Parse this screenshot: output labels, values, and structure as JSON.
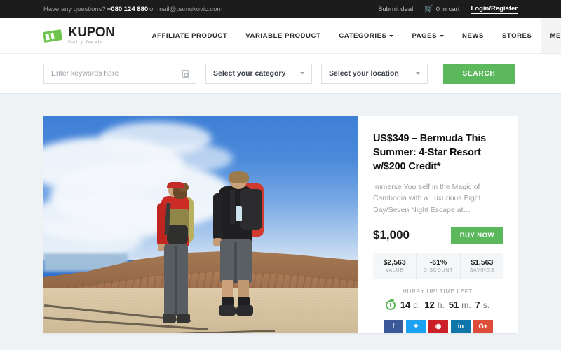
{
  "topbar": {
    "question_text": "Have any questions? ",
    "phone": "+080 124 880",
    "mail_text": " or mail@pamukovic.com",
    "submit_deal": "Submit deal",
    "cart_text": "0 in cart",
    "cart_icon": "cart-icon",
    "login_register": "Login/Register"
  },
  "header": {
    "logo_name": "KUPON",
    "logo_sub": "Daily Deals",
    "nav": [
      {
        "label": "AFFILIATE PRODUCT",
        "caret": false,
        "active": false
      },
      {
        "label": "VARIABLE PRODUCT",
        "caret": false,
        "active": false
      },
      {
        "label": "CATEGORIES",
        "caret": true,
        "active": false
      },
      {
        "label": "PAGES",
        "caret": true,
        "active": false
      },
      {
        "label": "NEWS",
        "caret": false,
        "active": false
      },
      {
        "label": "STORES",
        "caret": false,
        "active": false
      },
      {
        "label": "MEGA MENU",
        "caret": true,
        "active": true
      }
    ]
  },
  "search": {
    "keywords_placeholder": "Enter keywords here",
    "keywords_value": "",
    "keywords_icon": "keyboard-icon",
    "category_selected": "Select your category",
    "location_selected": "Select your location",
    "search_button": "SEARCH"
  },
  "deal": {
    "image_alt": "two-hikers-with-backpacks-on-desert-ridge",
    "title": "US$349 – Bermuda This Summer: 4-Star Resort w/$200 Credit*",
    "description": "Immerse Yourself in the Magic of Cambodia with a Luxurious Eight Day/Seven Night Escape at…",
    "price": "$1,000",
    "buy_button": "BUY NOW",
    "stats": [
      {
        "value": "$2,563",
        "label": "VALUE"
      },
      {
        "value": "-61%",
        "label": "DISCOUNT"
      },
      {
        "value": "$1,563",
        "label": "SAVINGS"
      }
    ],
    "timer_label": "HURRY UP! TIME LEFT:",
    "timer": [
      {
        "num": "14",
        "unit": "d."
      },
      {
        "num": "12",
        "unit": "h."
      },
      {
        "num": "51",
        "unit": "m."
      },
      {
        "num": "7",
        "unit": "s."
      }
    ],
    "social": [
      {
        "name": "facebook-share-button",
        "glyph": "f",
        "color": "#3b5998"
      },
      {
        "name": "twitter-share-button",
        "glyph": "✦",
        "color": "#1da1f2"
      },
      {
        "name": "pinterest-share-button",
        "glyph": "◉",
        "color": "#cb2027"
      },
      {
        "name": "linkedin-share-button",
        "glyph": "in",
        "color": "#0e76a8"
      },
      {
        "name": "googleplus-share-button",
        "glyph": "G+",
        "color": "#dd4b39"
      }
    ]
  },
  "colors": {
    "accent_green": "#5cb85c",
    "topbar_bg": "#1c1c1c",
    "page_bg": "#eef2f5"
  }
}
